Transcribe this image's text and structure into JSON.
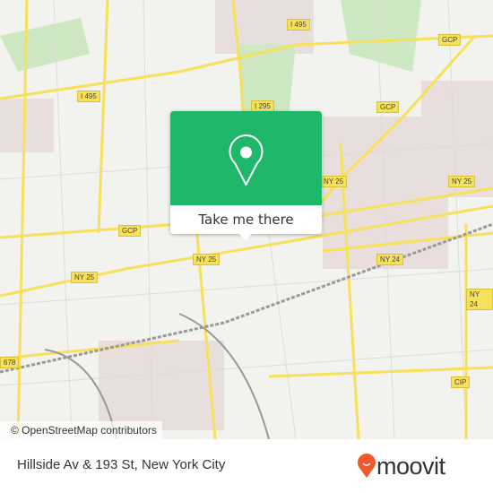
{
  "map": {
    "attribution": "© OpenStreetMap contributors",
    "road_labels": [
      "I 495",
      "I 495",
      "I 295",
      "GCP",
      "GCP",
      "GCP",
      "NY 25",
      "NY 25",
      "NY 25",
      "NY 25",
      "NY 24",
      "NY 24",
      "CIP",
      "678"
    ],
    "colors": {
      "land": "#f2f2ef",
      "road": "#f7e15a",
      "park": "#cfe8c4",
      "urban": "#e8dedb"
    }
  },
  "popup": {
    "button_label": "Take me there",
    "icon": "map-pin-icon",
    "color": "#1fb86b"
  },
  "footer": {
    "address": "Hillside Av & 193 St, New York City",
    "brand": "moovit",
    "brand_color": "#f0592b"
  }
}
